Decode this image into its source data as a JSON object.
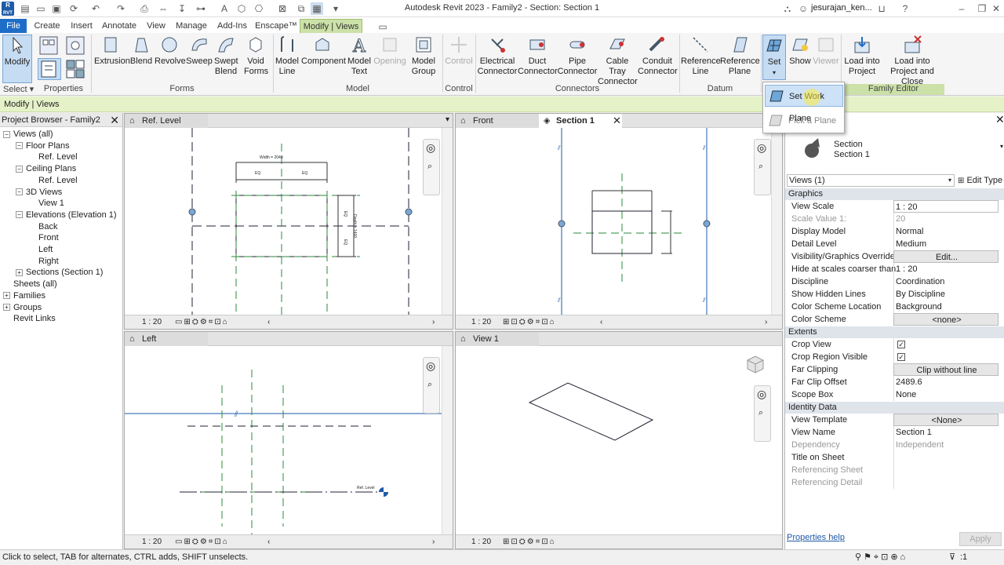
{
  "app": {
    "title": "Autodesk Revit 2023 - Family2 - Section: Section 1",
    "logo_text": "R",
    "logo_sub": "RVT",
    "user": "jesurajan_ken...",
    "accent": "#1e6ec8"
  },
  "tabs": [
    {
      "label": "File"
    },
    {
      "label": "Create"
    },
    {
      "label": "Insert"
    },
    {
      "label": "Annotate"
    },
    {
      "label": "View"
    },
    {
      "label": "Manage"
    },
    {
      "label": "Add-Ins"
    },
    {
      "label": "Enscape™"
    },
    {
      "label": "Modify | Views"
    }
  ],
  "ribbon": {
    "modify": "Modify",
    "select": "Select ▾",
    "properties": "Properties",
    "forms": {
      "label": "Forms",
      "items": [
        "Extrusion",
        "Blend",
        "Revolve",
        "Sweep",
        "Swept Blend",
        "Void Forms"
      ]
    },
    "model": {
      "label": "Model",
      "items": [
        "Model Line",
        "Component",
        "Model Text",
        "Opening",
        "Model Group"
      ]
    },
    "control": {
      "label": "Control",
      "items": [
        "Control"
      ]
    },
    "connectors": {
      "label": "Connectors",
      "items": [
        "Electrical Connector",
        "Duct Connector",
        "Pipe Connector",
        "Cable Tray Connector",
        "Conduit Connector"
      ]
    },
    "datum": {
      "label": "Datum",
      "items": [
        "Reference Line",
        "Reference Plane"
      ]
    },
    "workplane": {
      "items": [
        "Set",
        "Show",
        "Viewer"
      ]
    },
    "family_editor": {
      "label": "Family Editor",
      "items": [
        "Load into Project",
        "Load into Project and Close"
      ]
    }
  },
  "dropdown": {
    "items": [
      {
        "label": "Set Work Plane"
      },
      {
        "label": "Pick a Plane"
      }
    ]
  },
  "options_bar": {
    "text": "Modify | Views"
  },
  "project_browser": {
    "title": "Project Browser - Family2",
    "nodes": [
      {
        "label": "Views (all)",
        "level": 0,
        "exp": "−"
      },
      {
        "label": "Floor Plans",
        "level": 1,
        "exp": "−"
      },
      {
        "label": "Ref. Level",
        "level": 2,
        "exp": ""
      },
      {
        "label": "Ceiling Plans",
        "level": 1,
        "exp": "−"
      },
      {
        "label": "Ref. Level",
        "level": 2,
        "exp": ""
      },
      {
        "label": "3D Views",
        "level": 1,
        "exp": "−"
      },
      {
        "label": "View 1",
        "level": 2,
        "exp": ""
      },
      {
        "label": "Elevations (Elevation 1)",
        "level": 1,
        "exp": "−"
      },
      {
        "label": "Back",
        "level": 2,
        "exp": ""
      },
      {
        "label": "Front",
        "level": 2,
        "exp": ""
      },
      {
        "label": "Left",
        "level": 2,
        "exp": ""
      },
      {
        "label": "Right",
        "level": 2,
        "exp": ""
      },
      {
        "label": "Sections (Section 1)",
        "level": 1,
        "exp": "+"
      },
      {
        "label": "Sheets (all)",
        "level": 0,
        "exp": ""
      },
      {
        "label": "Families",
        "level": 0,
        "exp": "+"
      },
      {
        "label": "Groups",
        "level": 0,
        "exp": "+"
      },
      {
        "label": "Revit Links",
        "level": 0,
        "exp": ""
      }
    ]
  },
  "views": {
    "ref_level": {
      "title": "Ref. Level",
      "scale": "1 : 20",
      "dim_top": "Width = 2040",
      "eq": "EQ",
      "dim_side": "Depth = 1400"
    },
    "front": {
      "title": "Front"
    },
    "section1": {
      "title": "Section 1",
      "scale": "1 : 20"
    },
    "left": {
      "title": "Left",
      "scale": "1 : 20",
      "level_tag": "Ref. Level"
    },
    "view1": {
      "title": "View 1",
      "scale": "1 : 20"
    }
  },
  "properties": {
    "type_name": "Section",
    "type_sub": "Section 1",
    "selector": "Views (1)",
    "edit_type": "Edit Type",
    "groups": {
      "graphics": "Graphics",
      "extents": "Extents",
      "identity": "Identity Data"
    },
    "rows": {
      "view_scale": {
        "k": "View Scale",
        "v": "1 : 20"
      },
      "scale_value": {
        "k": "Scale Value    1:",
        "v": "20"
      },
      "display_model": {
        "k": "Display Model",
        "v": "Normal"
      },
      "detail_level": {
        "k": "Detail Level",
        "v": "Medium"
      },
      "vg": {
        "k": "Visibility/Graphics Overrides",
        "v": "Edit..."
      },
      "hide_scale": {
        "k": "Hide at scales coarser than",
        "v": "1 : 20"
      },
      "discipline": {
        "k": "Discipline",
        "v": "Coordination"
      },
      "hidden_lines": {
        "k": "Show Hidden Lines",
        "v": "By Discipline"
      },
      "csl": {
        "k": "Color Scheme Location",
        "v": "Background"
      },
      "cs": {
        "k": "Color Scheme",
        "v": "<none>"
      },
      "crop_view": {
        "k": "Crop View",
        "v": "✓"
      },
      "crop_region": {
        "k": "Crop Region Visible",
        "v": "✓"
      },
      "far_clip": {
        "k": "Far Clipping",
        "v": "Clip without line"
      },
      "far_offset": {
        "k": "Far Clip Offset",
        "v": "2489.6"
      },
      "scope_box": {
        "k": "Scope Box",
        "v": "None"
      },
      "view_template": {
        "k": "View Template",
        "v": "<None>"
      },
      "view_name": {
        "k": "View Name",
        "v": "Section 1"
      },
      "dependency": {
        "k": "Dependency",
        "v": "Independent"
      },
      "title_sheet": {
        "k": "Title on Sheet",
        "v": ""
      },
      "ref_sheet": {
        "k": "Referencing Sheet",
        "v": ""
      },
      "ref_detail": {
        "k": "Referencing Detail",
        "v": ""
      }
    },
    "help": "Properties help",
    "apply": "Apply"
  },
  "status": {
    "text": "Click to select, TAB for alternates, CTRL adds, SHIFT unselects.",
    "filter_count": ":1"
  }
}
